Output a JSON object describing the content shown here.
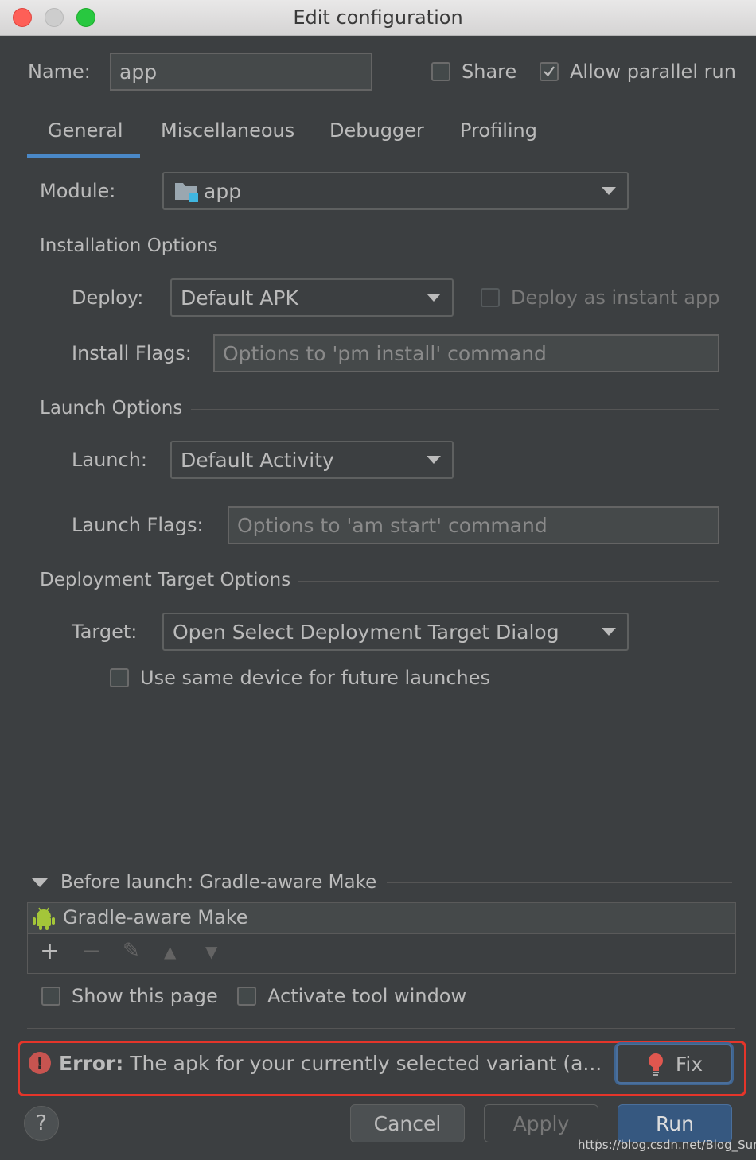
{
  "window": {
    "title": "Edit configuration"
  },
  "top": {
    "name_label": "Name:",
    "name_value": "app",
    "share_label": "Share",
    "share_checked": false,
    "parallel_label": "Allow parallel run",
    "parallel_checked": true
  },
  "tabs": [
    {
      "label": "General",
      "selected": true
    },
    {
      "label": "Miscellaneous",
      "selected": false
    },
    {
      "label": "Debugger",
      "selected": false
    },
    {
      "label": "Profiling",
      "selected": false
    }
  ],
  "module": {
    "label": "Module:",
    "value": "app",
    "icon": "module-folder-icon"
  },
  "installation": {
    "title": "Installation Options",
    "deploy_label": "Deploy:",
    "deploy_value": "Default APK",
    "instant_label": "Deploy as instant app",
    "instant_checked": false,
    "flags_label": "Install Flags:",
    "flags_placeholder": "Options to 'pm install' command"
  },
  "launch": {
    "title": "Launch Options",
    "launch_label": "Launch:",
    "launch_value": "Default Activity",
    "flags_label": "Launch Flags:",
    "flags_placeholder": "Options to 'am start' command"
  },
  "deployment": {
    "title": "Deployment Target Options",
    "target_label": "Target:",
    "target_value": "Open Select Deployment Target Dialog",
    "same_device_label": "Use same device for future launches",
    "same_device_checked": false
  },
  "before_launch": {
    "title": "Before launch: Gradle-aware Make",
    "items": [
      {
        "label": "Gradle-aware Make",
        "icon": "android-icon"
      }
    ],
    "toolbar": [
      "add-icon",
      "remove-icon",
      "edit-icon",
      "move-up-icon",
      "move-down-icon"
    ],
    "toolbar_glyphs": {
      "add": "+",
      "remove": "−",
      "edit": "✎",
      "up": "▲",
      "down": "▼"
    },
    "show_page_label": "Show this page",
    "activate_label": "Activate tool window"
  },
  "error": {
    "icon_glyph": "!",
    "prefix": "Error:",
    "message": "The apk for your currently selected variant (a...",
    "fix_label": "Fix"
  },
  "footer": {
    "help_glyph": "?",
    "cancel_label": "Cancel",
    "apply_label": "Apply",
    "run_label": "Run"
  },
  "watermark": "https://blog.csdn.net/Blog_Sun",
  "colors": {
    "accent": "#4a88c7",
    "error_outline": "#e5352a",
    "error_icon": "#c75450",
    "android": "#a4c639"
  }
}
